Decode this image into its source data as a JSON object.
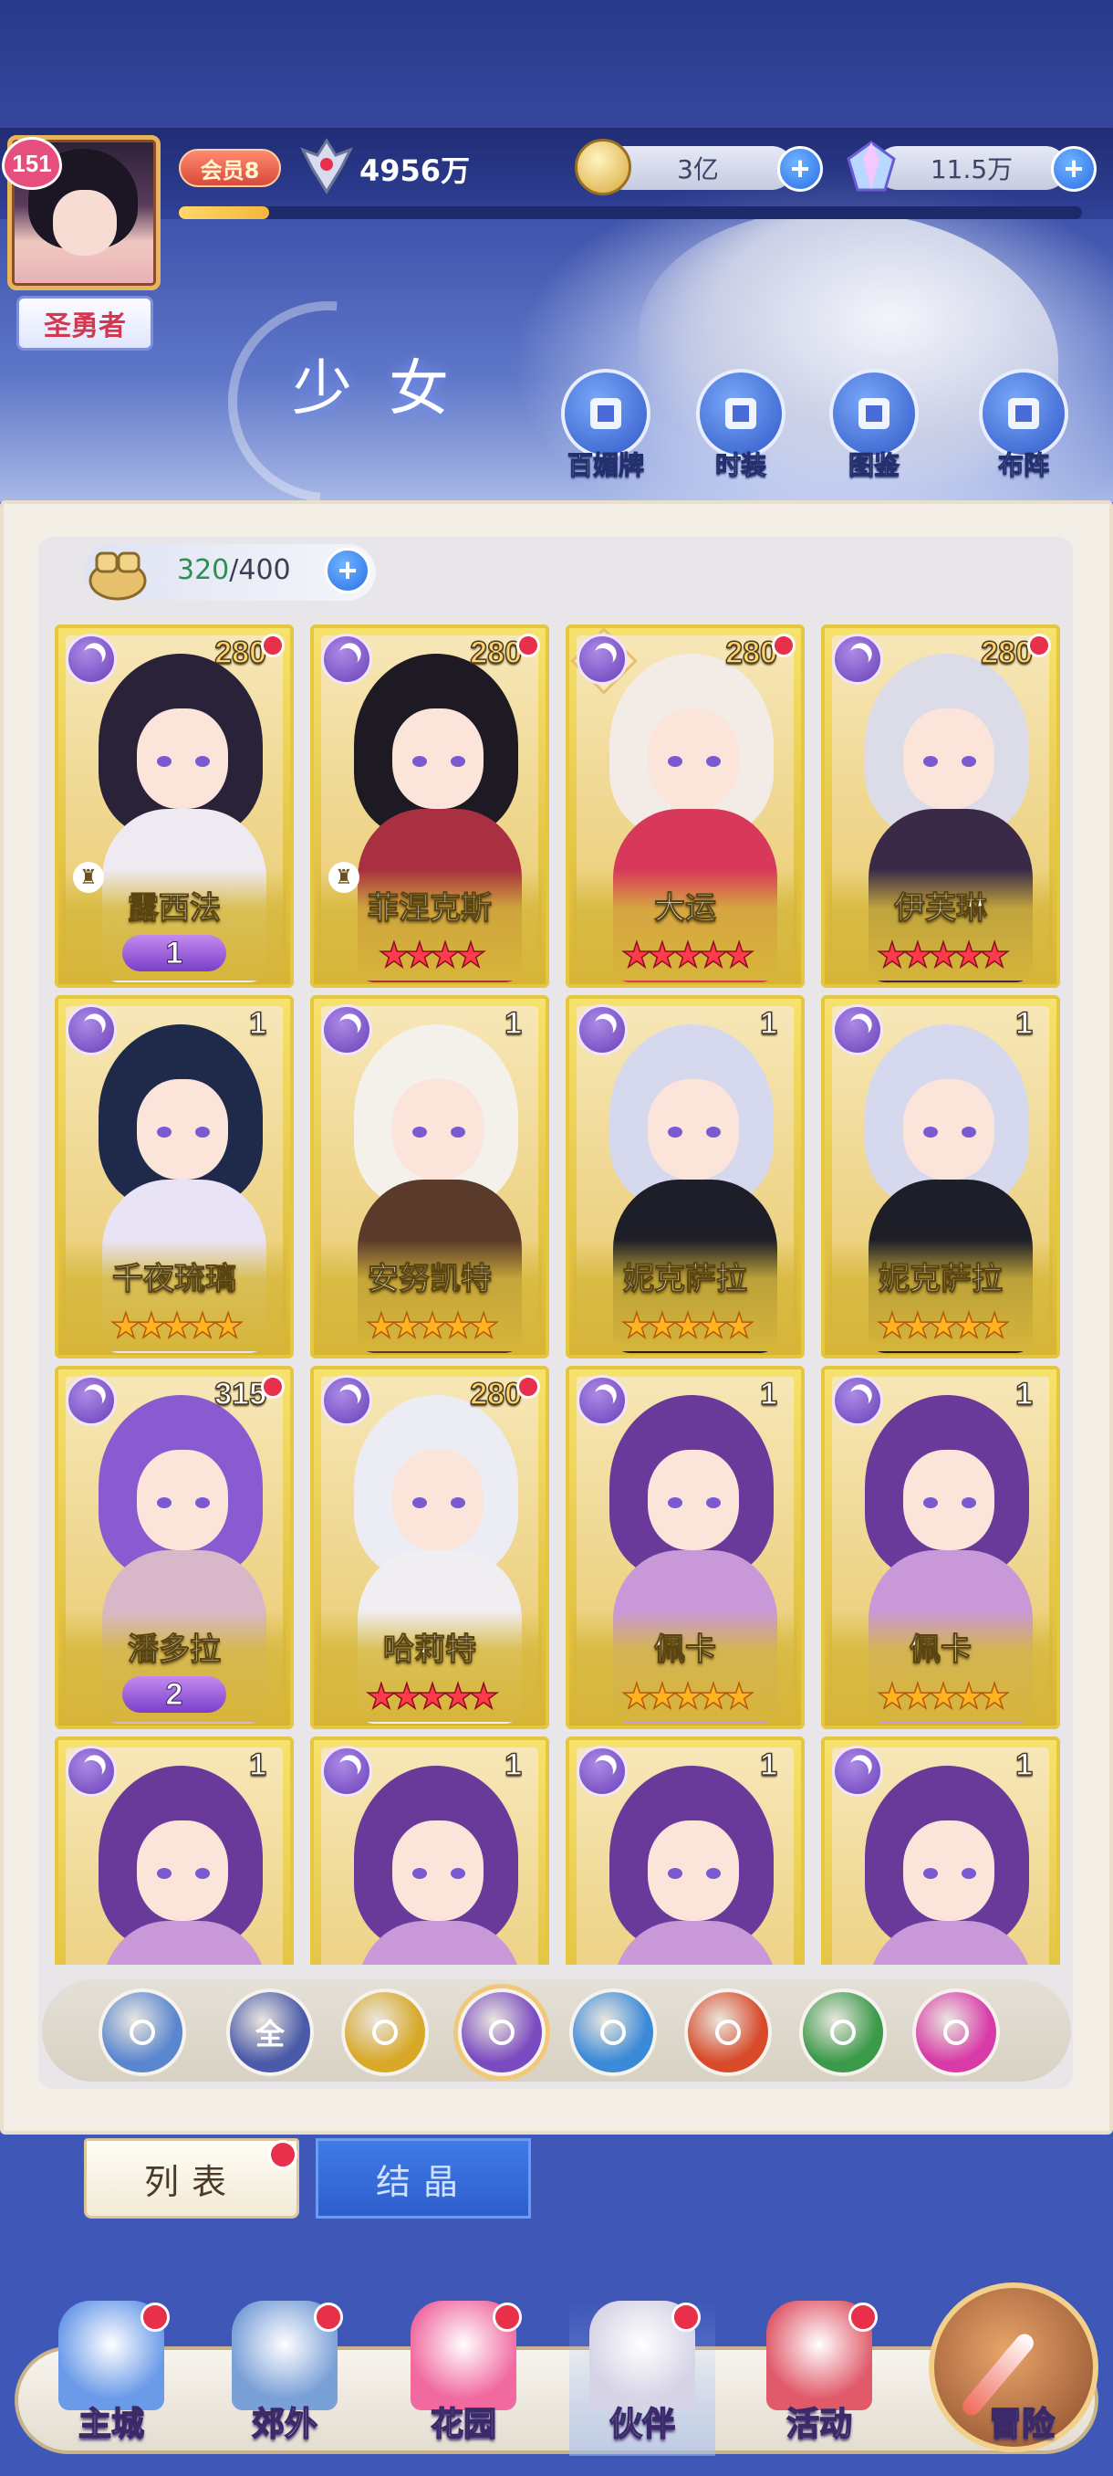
{
  "header": {
    "level": "151",
    "title_badge": "圣勇者",
    "vip_label": "会员8",
    "power": "4956万",
    "exp_fraction": 0.1,
    "gold": "3亿",
    "diamond": "11.5万",
    "page_title": "少女",
    "nav": [
      {
        "label": "百媚牌",
        "icon": "card-deck-icon"
      },
      {
        "label": "时装",
        "icon": "costume-icon"
      },
      {
        "label": "图鉴",
        "icon": "codex-book-icon"
      },
      {
        "label": "布阵",
        "icon": "formation-grid-icon"
      }
    ]
  },
  "capacity": {
    "current": "320",
    "max": "/400"
  },
  "cards": [
    {
      "name": "露西法",
      "level": "280",
      "wings": "1",
      "dot": true,
      "rook": true,
      "hair": "#2a2238",
      "body": "#efeaf2"
    },
    {
      "name": "菲涅克斯",
      "level": "280",
      "stars": 4,
      "star_color": "red",
      "dot": true,
      "rook": true,
      "hair": "#1e1a24",
      "body": "#a83040"
    },
    {
      "name": "大运",
      "level": "280",
      "stars": 5,
      "star_color": "red",
      "dot": true,
      "diamond": true,
      "hair": "#f3ece6",
      "body": "#d8385a"
    },
    {
      "name": "伊芙琳",
      "level": "280",
      "stars": 5,
      "star_color": "red",
      "dot": true,
      "hair": "#dcdce8",
      "body": "#3a2a48"
    },
    {
      "name": "千夜琉璃",
      "level": "1",
      "stars": 5,
      "star_color": "gold",
      "hair": "#1f2a4a",
      "body": "#e8e4f6"
    },
    {
      "name": "安努凯特",
      "level": "1",
      "stars": 5,
      "star_color": "gold",
      "hair": "#f4f0ea",
      "body": "#5a3a2a"
    },
    {
      "name": "妮克萨拉",
      "level": "1",
      "stars": 5,
      "star_color": "gold",
      "hair": "#d6d8ee",
      "body": "#1e1e28"
    },
    {
      "name": "妮克萨拉",
      "level": "1",
      "stars": 5,
      "star_color": "gold",
      "hair": "#d6d8ee",
      "body": "#1e1e28"
    },
    {
      "name": "潘多拉",
      "level": "315",
      "wings": "2",
      "dot": true,
      "hair": "#8a5ad0",
      "body": "#d8b8c8"
    },
    {
      "name": "哈莉特",
      "level": "280",
      "stars": 5,
      "star_color": "red",
      "dot": true,
      "hair": "#ececf4",
      "body": "#f1eef2"
    },
    {
      "name": "佩卡",
      "level": "1",
      "stars": 5,
      "star_color": "gold",
      "hair": "#6a3a9a",
      "body": "#c898d8"
    },
    {
      "name": "佩卡",
      "level": "1",
      "stars": 5,
      "star_color": "gold",
      "hair": "#6a3a9a",
      "body": "#c898d8"
    },
    {
      "name": "",
      "level": "1",
      "hair": "#6a3a9a",
      "body": "#c898d8"
    },
    {
      "name": "",
      "level": "1",
      "hair": "#6a3a9a",
      "body": "#c898d8"
    },
    {
      "name": "",
      "level": "1",
      "hair": "#6a3a9a",
      "body": "#c898d8"
    },
    {
      "name": "",
      "level": "1",
      "hair": "#6a3a9a",
      "body": "#c898d8"
    }
  ],
  "filters": [
    {
      "name": "filter-light-icon",
      "label": "",
      "color": "#5a86d0"
    },
    {
      "name": "filter-all",
      "label": "全",
      "color": "#4a5aa8"
    },
    {
      "name": "filter-sun-icon",
      "label": "",
      "color": "#d8a828"
    },
    {
      "name": "filter-moon-icon",
      "label": "",
      "color": "#7a4ac0",
      "selected": true
    },
    {
      "name": "filter-water-icon",
      "label": "",
      "color": "#3a8ad8"
    },
    {
      "name": "filter-fire-icon",
      "label": "",
      "color": "#d84a2a"
    },
    {
      "name": "filter-wind-icon",
      "label": "",
      "color": "#3a9a4a"
    },
    {
      "name": "filter-star-icon",
      "label": "",
      "color": "#d83aa8"
    }
  ],
  "tabs": {
    "list": "列表",
    "crystal": "结晶"
  },
  "bottom_nav": [
    {
      "label": "主城",
      "icon": "castle-icon",
      "color": "#6a9ae8"
    },
    {
      "label": "郊外",
      "icon": "gate-icon",
      "color": "#7aa0d8"
    },
    {
      "label": "花园",
      "icon": "heart-icon",
      "color": "#f06aa0"
    },
    {
      "label": "伙伴",
      "icon": "partner-avatar-icon",
      "color": "#d6d4e6",
      "active": true
    },
    {
      "label": "活动",
      "icon": "gift-box-icon",
      "color": "#e05a6a"
    },
    {
      "label": "冒险",
      "icon": "compass-icon",
      "color": "#e9a46a"
    }
  ]
}
